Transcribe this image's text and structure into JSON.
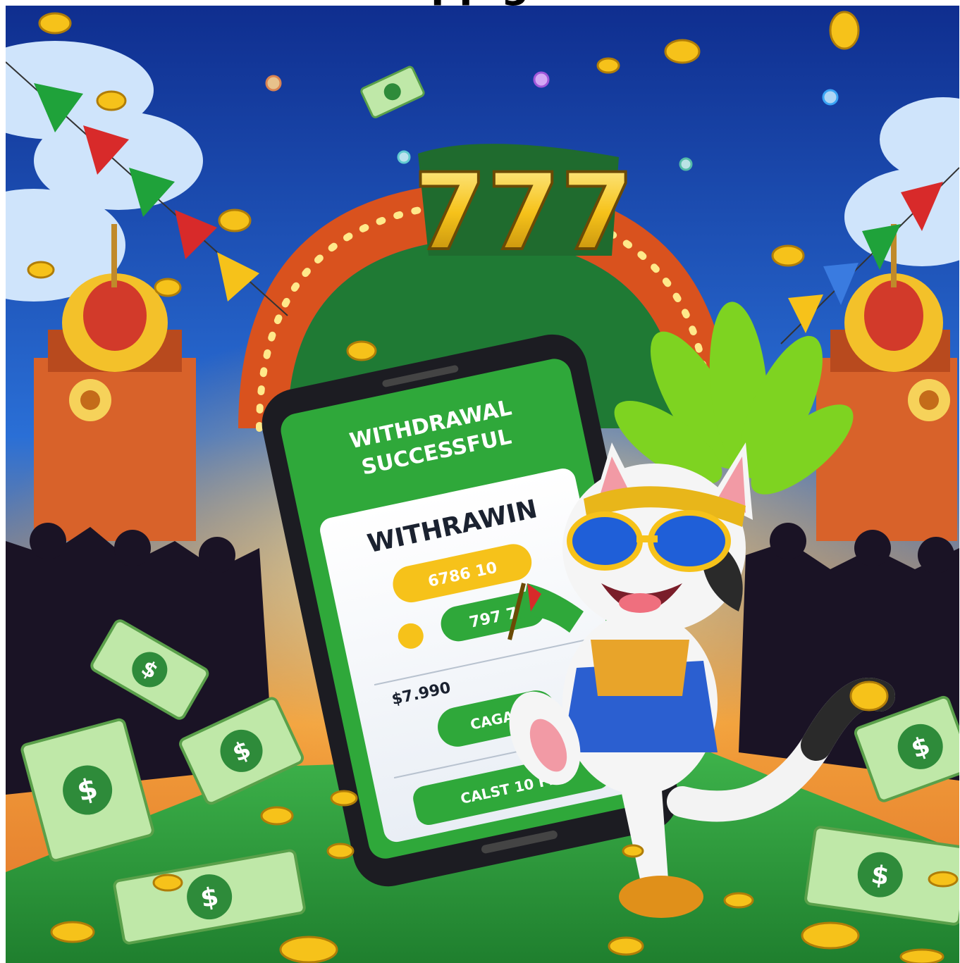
{
  "caption": {
    "partial_title": "pp    g"
  },
  "sign": {
    "jackpot": "777"
  },
  "phone": {
    "headline_line1": "WITHDRAWAL",
    "headline_line2": "SUCCESSFUL",
    "card_title": "WITHRAWIN",
    "amount_pill": "6786 10",
    "code_pill": "797 7",
    "balance": "$7.990",
    "button_1": "CAGAS",
    "button_2": "CALST 10 FIE"
  },
  "colors": {
    "sky": "#1e4fb8",
    "brand_green": "#2fa83a",
    "gold": "#f6c21a",
    "stage_green": "#2e9b3c"
  },
  "icons": [
    "fireworks",
    "coin",
    "dollar-bill",
    "pennant-flags",
    "cat-mascot",
    "smartphone"
  ]
}
